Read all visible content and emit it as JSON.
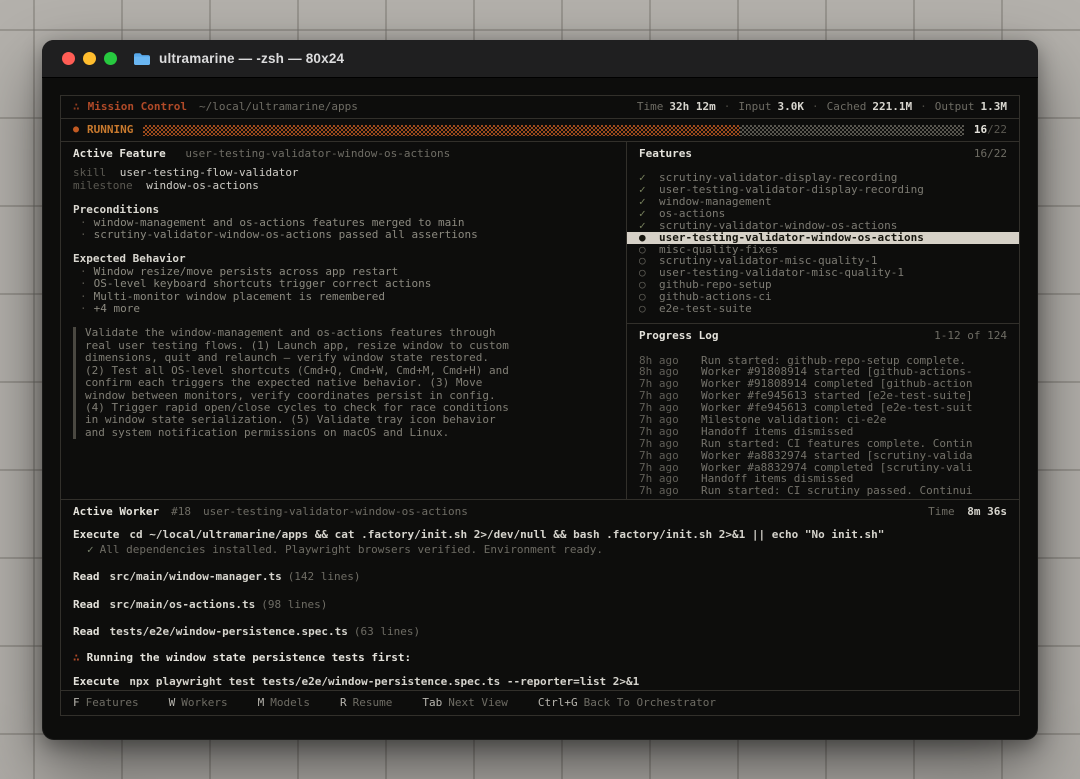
{
  "window": {
    "title": "ultramarine — -zsh — 80x24"
  },
  "icons": {
    "app": "∴",
    "run_dot": "●",
    "check": "✓",
    "active_bullet": "●",
    "pending_circle": "○",
    "bullet": "·",
    "result_check": "✓"
  },
  "header": {
    "app_name": "Mission Control",
    "path": "~/local/ultramarine/apps",
    "sep": "·",
    "stats": [
      {
        "label": "Time",
        "value": "32h 12m"
      },
      {
        "label": "Input",
        "value": "3.0K"
      },
      {
        "label": "Cached",
        "value": "221.1M"
      },
      {
        "label": "Output",
        "value": "1.3M"
      }
    ]
  },
  "status_bar": {
    "state": "RUNNING",
    "progress_current": "16",
    "progress_total": "/22",
    "progress_fraction": 0.727,
    "fill_color": "#9c4a1c"
  },
  "active_feature": {
    "label": "Active Feature",
    "name": "user-testing-validator-window-os-actions",
    "skill_label": "skill",
    "skill": "user-testing-flow-validator",
    "milestone_label": "milestone",
    "milestone": "window-os-actions",
    "preconditions_title": "Preconditions",
    "preconditions": [
      "window-management and os-actions features merged to main",
      "scrutiny-validator-window-os-actions passed all assertions"
    ],
    "expected_title": "Expected Behavior",
    "expected": [
      "Window resize/move persists across app restart",
      "OS-level keyboard shortcuts trigger correct actions",
      "Multi-monitor window placement is remembered",
      "+4 more"
    ],
    "description": "Validate the window-management and os-actions features through real user testing flows. (1) Launch app, resize window to custom dimensions, quit and relaunch — verify window state restored. (2) Test all OS-level shortcuts (Cmd+Q, Cmd+W, Cmd+M, Cmd+H) and confirm each triggers the expected native behavior. (3) Move window between monitors, verify coordinates persist in config. (4) Trigger rapid open/close cycles to check for race conditions in window state serialization. (5) Validate tray icon behavior and system notification permissions on macOS and Linux."
  },
  "features_panel": {
    "title": "Features",
    "count": "16/22",
    "items": [
      {
        "status": "done",
        "name": "scrutiny-validator-display-recording"
      },
      {
        "status": "done",
        "name": "user-testing-validator-display-recording"
      },
      {
        "status": "done",
        "name": "window-management"
      },
      {
        "status": "done",
        "name": "os-actions"
      },
      {
        "status": "done",
        "name": "scrutiny-validator-window-os-actions"
      },
      {
        "status": "active",
        "name": "user-testing-validator-window-os-actions"
      },
      {
        "status": "pending",
        "name": "misc-quality-fixes"
      },
      {
        "status": "pending",
        "name": "scrutiny-validator-misc-quality-1"
      },
      {
        "status": "pending",
        "name": "user-testing-validator-misc-quality-1"
      },
      {
        "status": "pending",
        "name": "github-repo-setup"
      },
      {
        "status": "pending",
        "name": "github-actions-ci"
      },
      {
        "status": "pending",
        "name": "e2e-test-suite"
      }
    ]
  },
  "progress_log": {
    "title": "Progress Log",
    "range": "1-12 of 124",
    "entries": [
      {
        "time": "8h ago",
        "message": "Run started: github-repo-setup complete."
      },
      {
        "time": "8h ago",
        "message": "Worker #91808914 started [github-actions-"
      },
      {
        "time": "7h ago",
        "message": "Worker #91808914 completed [github-action"
      },
      {
        "time": "7h ago",
        "message": "Worker #fe945613 started [e2e-test-suite]"
      },
      {
        "time": "7h ago",
        "message": "Worker #fe945613 completed [e2e-test-suit"
      },
      {
        "time": "7h ago",
        "message": "Milestone validation: ci-e2e"
      },
      {
        "time": "7h ago",
        "message": "Handoff items dismissed"
      },
      {
        "time": "7h ago",
        "message": "Run started: CI features complete. Contin"
      },
      {
        "time": "7h ago",
        "message": "Worker #a8832974 started [scrutiny-valida"
      },
      {
        "time": "7h ago",
        "message": "Worker #a8832974 completed [scrutiny-vali"
      },
      {
        "time": "7h ago",
        "message": "Handoff items dismissed"
      },
      {
        "time": "7h ago",
        "message": "Run started: CI scrutiny passed. Continui"
      }
    ]
  },
  "active_worker": {
    "label": "Active Worker",
    "id": "#18",
    "name": "user-testing-validator-window-os-actions",
    "time_label": "Time",
    "time_value": "8m 36s",
    "execute_label": "Execute",
    "read_label": "Read",
    "step1_command": "cd ~/local/ultramarine/apps && cat .factory/init.sh 2>/dev/null && bash .factory/init.sh 2>&1 || echo \"No init.sh\"",
    "step1_result": "All dependencies installed. Playwright browsers verified. Environment ready.",
    "read1_path": "src/main/window-manager.ts",
    "read1_meta": "(142 lines)",
    "read2_path": "src/main/os-actions.ts",
    "read2_meta": "(98 lines)",
    "read3_path": "tests/e2e/window-persistence.spec.ts",
    "read3_meta": "(63 lines)",
    "note": "Running the window state persistence tests first:",
    "step2_command": "npx playwright test tests/e2e/window-persistence.spec.ts --reporter=list 2>&1"
  },
  "footer": {
    "shortcuts": [
      {
        "key": "F",
        "label": "Features"
      },
      {
        "key": "W",
        "label": "Workers"
      },
      {
        "key": "M",
        "label": "Models"
      },
      {
        "key": "R",
        "label": "Resume"
      },
      {
        "key": "Tab",
        "label": "Next View"
      },
      {
        "key": "Ctrl+G",
        "label": "Back To Orchestrator"
      }
    ]
  }
}
